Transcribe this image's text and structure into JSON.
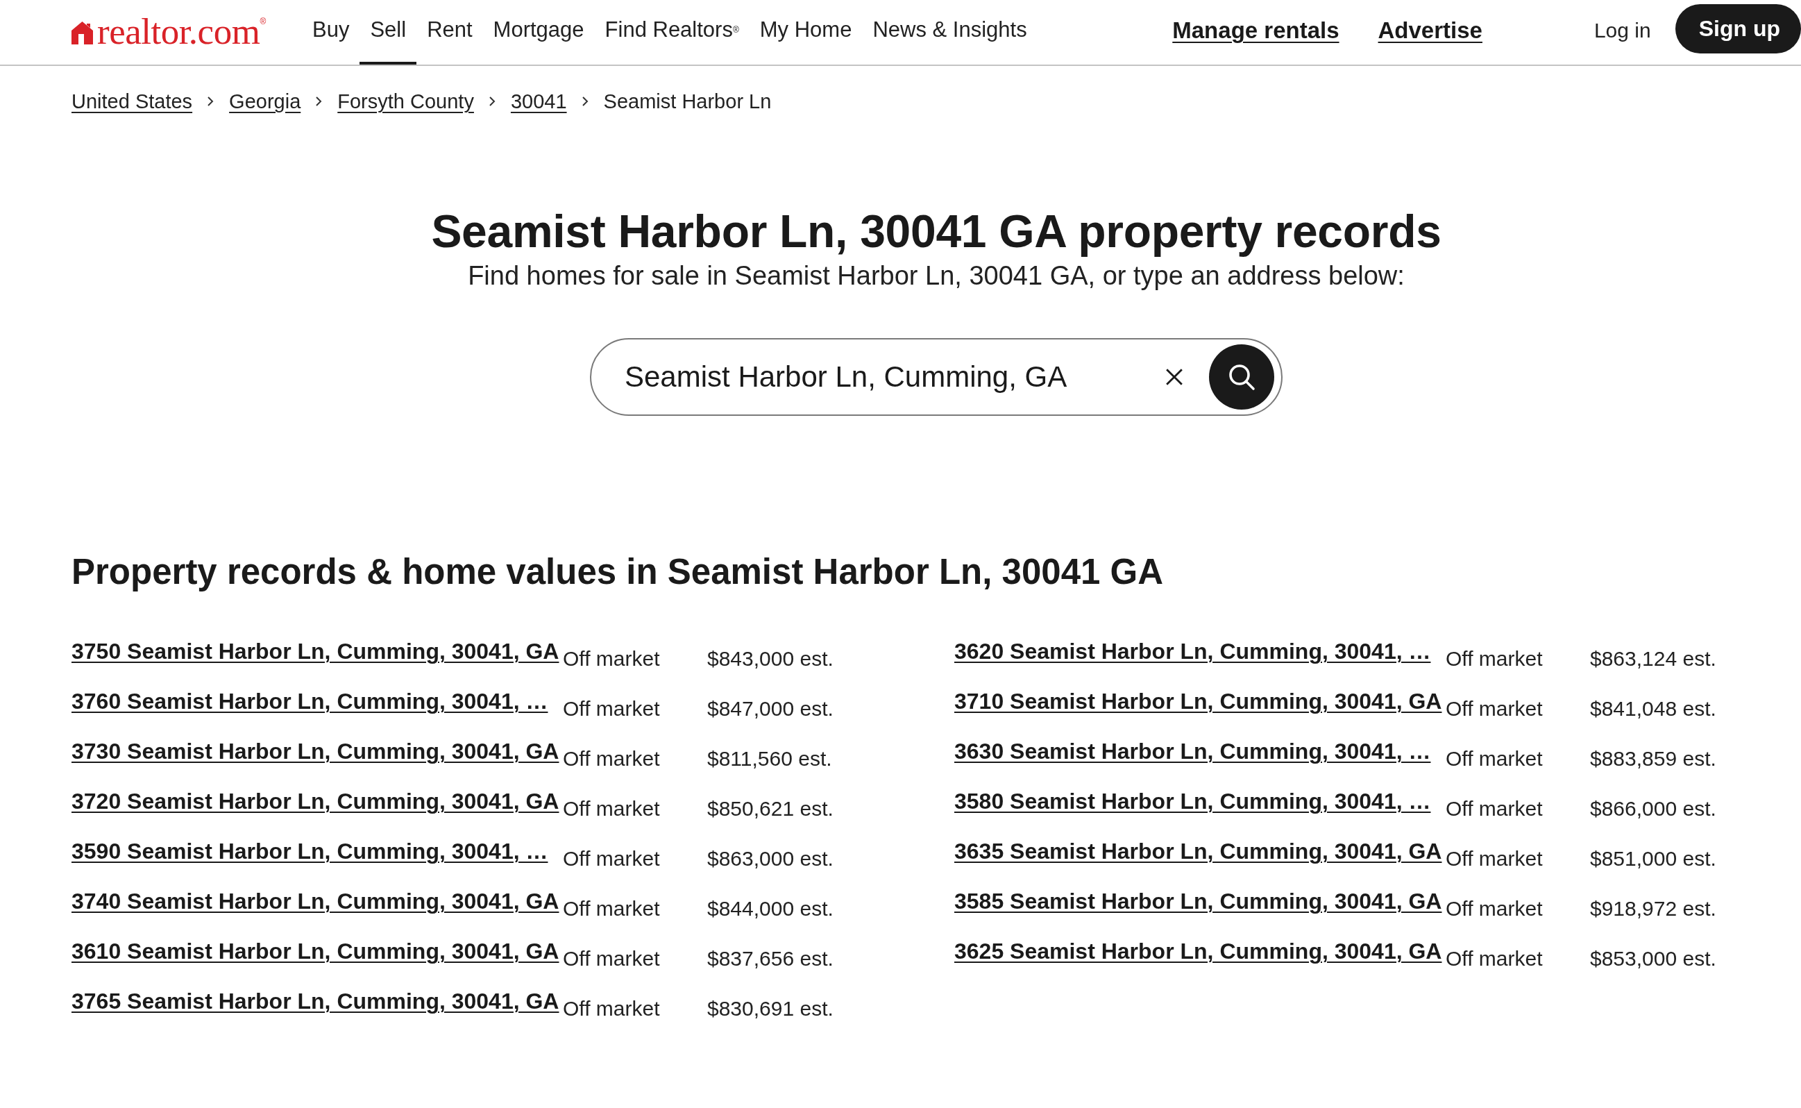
{
  "header": {
    "logo": "realtor.com$^{®}$",
    "nav": [
      {
        "label": "Buy",
        "selected": false
      },
      {
        "label": "Sell",
        "selected": true
      },
      {
        "label": "Rent",
        "selected": false
      },
      {
        "label": "Mortgage",
        "selected": false
      },
      {
        "label": "Find Realtors$^{®}$",
        "selected": false
      },
      {
        "label": "My Home",
        "selected": false
      },
      {
        "label": "News & Insights",
        "selected": false
      }
    ],
    "links": [
      "Manage rentals",
      "Advertise"
    ],
    "login": "Log in",
    "signup": "Sign up"
  },
  "breadcrumbs": [
    {
      "label": "United States",
      "current": false
    },
    {
      "label": "Georgia",
      "current": false
    },
    {
      "label": "Forsyth County",
      "current": false
    },
    {
      "label": "30041",
      "current": false
    },
    {
      "label": "Seamist Harbor Ln",
      "current": true
    }
  ],
  "hero": {
    "title": "Seamist Harbor Ln, 30041 GA property records",
    "subtitle": "Find homes for sale in Seamist Harbor Ln, 30041 GA, or type an address below:",
    "search": {
      "value": "Seamist Harbor Ln, Cumming, GA"
    }
  },
  "records": {
    "heading": "Property records & home values in Seamist Harbor Ln, 30041 GA",
    "items": [
      {
        "address": "3750 Seamist Harbor Ln, Cumming, 30041, GA",
        "status": "Off market",
        "estimate": "$843,000 est."
      },
      {
        "address": "3760 Seamist Harbor Ln, Cumming, 30041, …",
        "status": "Off market",
        "estimate": "$847,000 est."
      },
      {
        "address": "3730 Seamist Harbor Ln, Cumming, 30041, GA",
        "status": "Off market",
        "estimate": "$811,560 est."
      },
      {
        "address": "3720 Seamist Harbor Ln, Cumming, 30041, GA",
        "status": "Off market",
        "estimate": "$850,621 est."
      },
      {
        "address": "3590 Seamist Harbor Ln, Cumming, 30041, …",
        "status": "Off market",
        "estimate": "$863,000 est."
      },
      {
        "address": "3740 Seamist Harbor Ln, Cumming, 30041, GA",
        "status": "Off market",
        "estimate": "$844,000 est."
      },
      {
        "address": "3610 Seamist Harbor Ln, Cumming, 30041, GA",
        "status": "Off market",
        "estimate": "$837,656 est."
      },
      {
        "address": "3765 Seamist Harbor Ln, Cumming, 30041, GA",
        "status": "Off market",
        "estimate": "$830,691 est."
      },
      {
        "address": "3620 Seamist Harbor Ln, Cumming, 30041, …",
        "status": "Off market",
        "estimate": "$863,124 est."
      },
      {
        "address": "3710 Seamist Harbor Ln, Cumming, 30041, GA",
        "status": "Off market",
        "estimate": "$841,048 est."
      },
      {
        "address": "3630 Seamist Harbor Ln, Cumming, 30041, …",
        "status": "Off market",
        "estimate": "$883,859 est."
      },
      {
        "address": "3580 Seamist Harbor Ln, Cumming, 30041, …",
        "status": "Off market",
        "estimate": "$866,000 est."
      },
      {
        "address": "3635 Seamist Harbor Ln, Cumming, 30041, GA",
        "status": "Off market",
        "estimate": "$851,000 est."
      },
      {
        "address": "3585 Seamist Harbor Ln, Cumming, 30041, GA",
        "status": "Off market",
        "estimate": "$918,972 est."
      },
      {
        "address": "3625 Seamist Harbor Ln, Cumming, 30041, GA",
        "status": "Off market",
        "estimate": "$853,000 est."
      }
    ]
  }
}
